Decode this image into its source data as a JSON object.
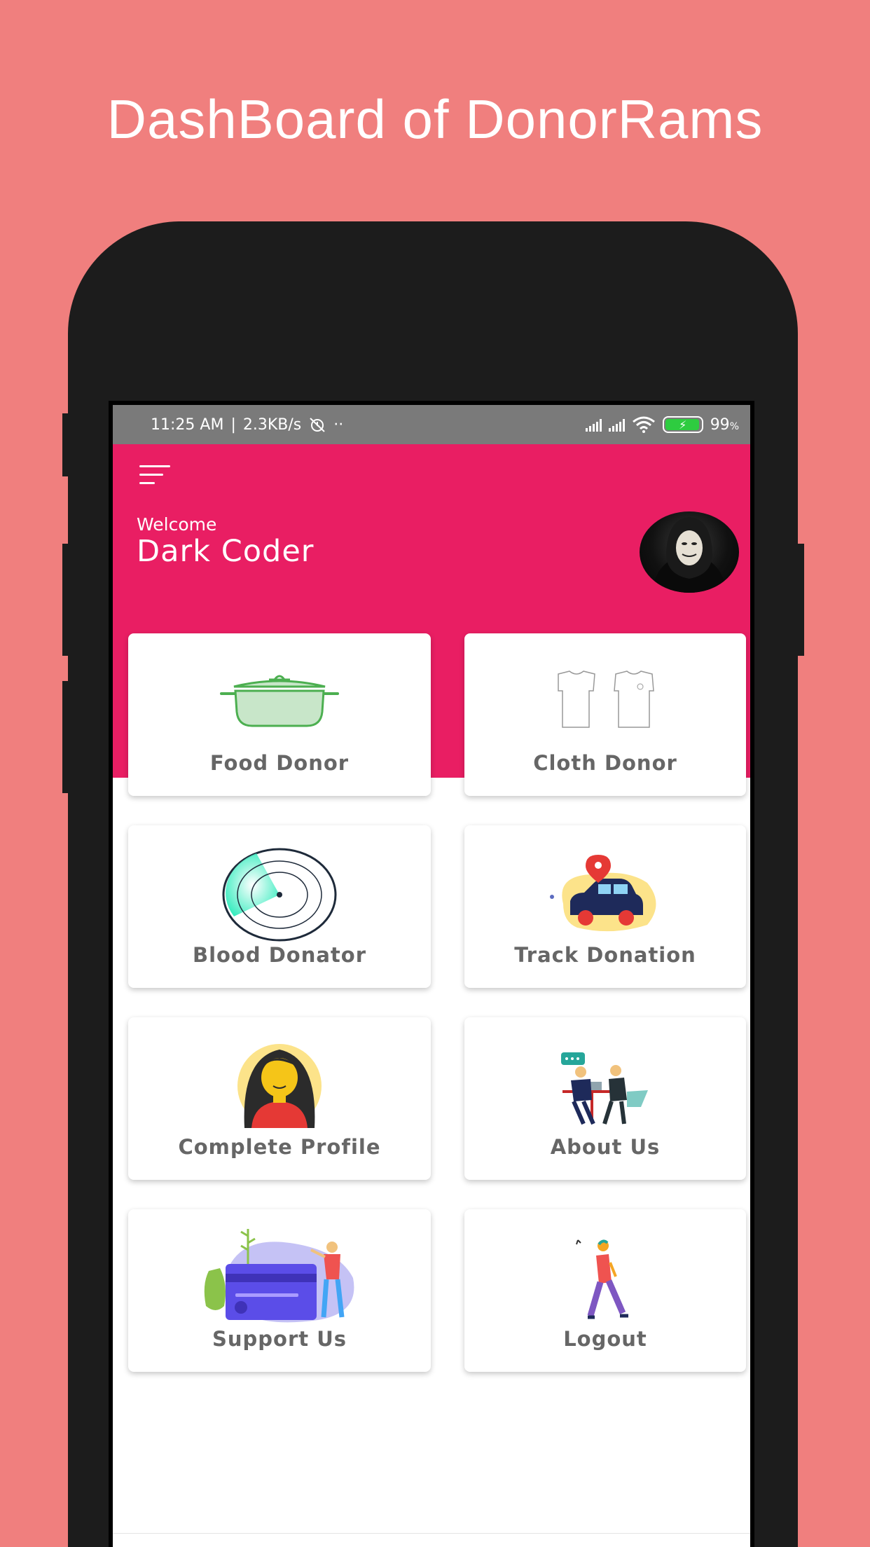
{
  "promo": {
    "title": "DashBoard of DonorRams"
  },
  "status_bar": {
    "time": "11:25 AM",
    "separator": "|",
    "speed": "2.3KB/s",
    "dots": "··",
    "battery": "99",
    "battery_unit": "%"
  },
  "header": {
    "welcome": "Welcome",
    "username": "Dark Coder",
    "menu_icon": "hamburger-menu-icon",
    "avatar_icon": "masked-user-avatar"
  },
  "cards": [
    {
      "label": "Food Donor",
      "icon": "cooking-pot-icon"
    },
    {
      "label": "Cloth Donor",
      "icon": "shirts-icon"
    },
    {
      "label": "Blood Donator",
      "icon": "radar-icon"
    },
    {
      "label": "Track Donation",
      "icon": "car-location-icon"
    },
    {
      "label": "Complete Profile",
      "icon": "profile-woman-icon"
    },
    {
      "label": "About Us",
      "icon": "team-meeting-icon"
    },
    {
      "label": "Support Us",
      "icon": "payment-card-icon"
    },
    {
      "label": "Logout",
      "icon": "walking-person-icon"
    }
  ],
  "nav": {
    "recent": "square-nav-icon",
    "home": "circle-nav-icon",
    "back": "triangle-nav-icon"
  },
  "colors": {
    "background": "#F07F7E",
    "header": "#E91E63",
    "status_bar": "#7A7A7A",
    "label": "#666666"
  }
}
